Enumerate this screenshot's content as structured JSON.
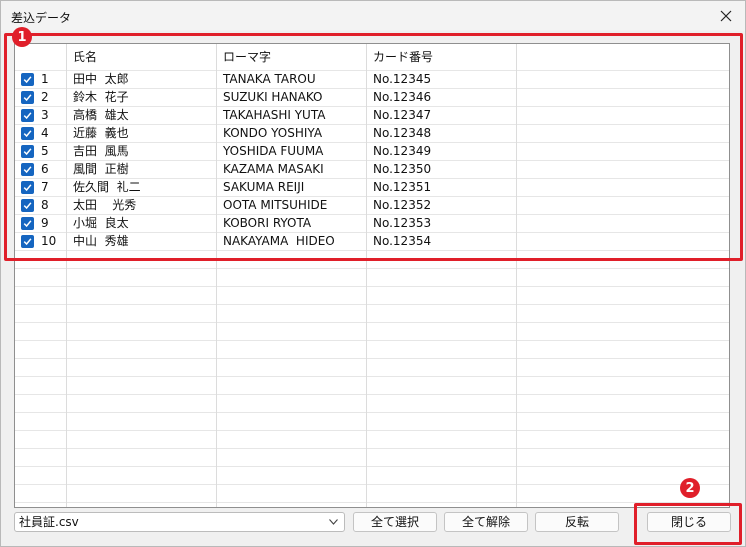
{
  "window": {
    "title": "差込データ"
  },
  "grid": {
    "headers": [
      "氏名",
      "ローマ字",
      "カード番号"
    ],
    "rows": [
      {
        "num": "1",
        "name": "田中  太郎",
        "roman": "TANAKA TAROU",
        "card": "No.12345",
        "checked": true
      },
      {
        "num": "2",
        "name": "鈴木  花子",
        "roman": "SUZUKI HANAKO",
        "card": "No.12346",
        "checked": true
      },
      {
        "num": "3",
        "name": "高橋  雄太",
        "roman": "TAKAHASHI YUTA",
        "card": "No.12347",
        "checked": true
      },
      {
        "num": "4",
        "name": "近藤  義也",
        "roman": "KONDO YOSHIYA",
        "card": "No.12348",
        "checked": true
      },
      {
        "num": "5",
        "name": "吉田  風馬",
        "roman": "YOSHIDA FUUMA",
        "card": "No.12349",
        "checked": true
      },
      {
        "num": "6",
        "name": "風間  正樹",
        "roman": "KAZAMA MASAKI",
        "card": "No.12350",
        "checked": true
      },
      {
        "num": "7",
        "name": "佐久間  礼二",
        "roman": "SAKUMA REIJI",
        "card": "No.12351",
        "checked": true
      },
      {
        "num": "8",
        "name": "太田    光秀",
        "roman": "OOTA MITSUHIDE",
        "card": "No.12352",
        "checked": true
      },
      {
        "num": "9",
        "name": "小堀  良太",
        "roman": "KOBORI RYOTA",
        "card": "No.12353",
        "checked": true
      },
      {
        "num": "10",
        "name": "中山  秀雄",
        "roman": "NAKAYAMA  HIDEO",
        "card": "No.12354",
        "checked": true
      }
    ]
  },
  "annotations": {
    "badge1": "1",
    "badge2": "2"
  },
  "footer": {
    "file_value": "社員証.csv",
    "select_all_label": "全て選択",
    "deselect_all_label": "全て解除",
    "invert_label": "反転",
    "close_label": "閉じる"
  },
  "colors": {
    "highlight": "#e01f2a",
    "checkbox": "#1565c0"
  }
}
